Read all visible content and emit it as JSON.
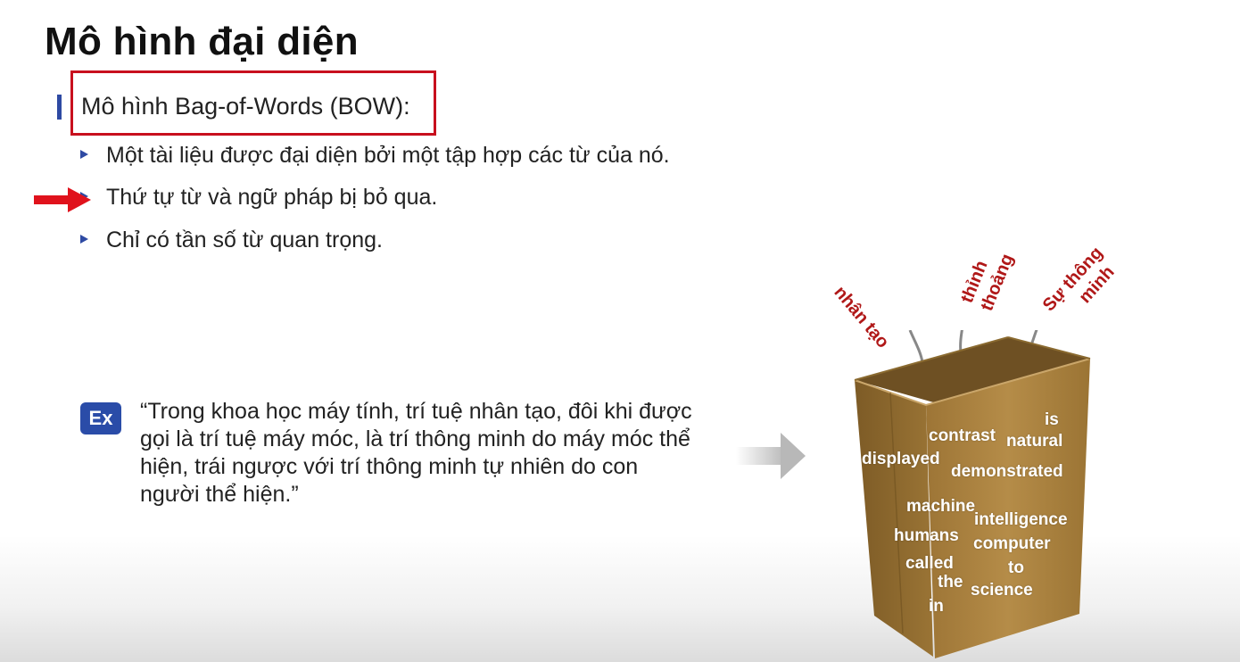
{
  "slide": {
    "title": "Mô hình đại diện",
    "section_label": "Mô hình Bag-of-Words (BOW):",
    "bullets": [
      "Một tài liệu được đại diện bởi một tập hợp các từ của nó.",
      "Thứ tự từ và ngữ pháp bị bỏ qua.",
      "Chỉ có tần số từ quan trọng."
    ],
    "example_badge": "Ex",
    "example_quote": "“Trong khoa học máy tính, trí tuệ nhân tạo, đôi khi được gọi là trí tuệ máy móc, là trí thông minh do máy móc thể hiện, trái ngược với trí thông minh tự nhiên do con người thể hiện.”"
  },
  "bag": {
    "outside_words": [
      {
        "line1": "nhân tạo",
        "line2": ""
      },
      {
        "line1": "thỉnh",
        "line2": "thoảng"
      },
      {
        "line1": "Sự thông",
        "line2": "minh"
      }
    ],
    "inside_words": [
      "is",
      "contrast",
      "natural",
      "displayed",
      "demonstrated",
      "machine",
      "intelligence",
      "humans",
      "computer",
      "called",
      "to",
      "the",
      "science",
      "in"
    ]
  },
  "colors": {
    "accent_blue": "#2e4aa3",
    "highlight_red": "#c8101e",
    "outside_word_red": "#b01818",
    "bag_brown": "#a9823f"
  },
  "icons": [
    "red-arrow-icon",
    "bullet-triangle-icon",
    "gray-arrow-icon",
    "paper-bag-icon"
  ]
}
